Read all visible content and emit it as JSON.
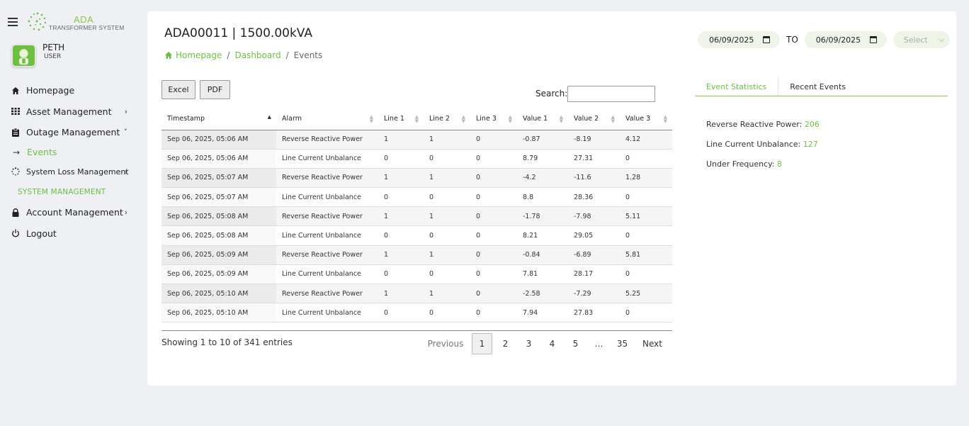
{
  "app": {
    "logo_title": "ADA",
    "logo_subtitle": "TRANSFORMER SYSTEM"
  },
  "user": {
    "name": "PETH",
    "role": "USER"
  },
  "sidebar": {
    "items": [
      {
        "label": "Homepage",
        "icon": "home-icon"
      },
      {
        "label": "Asset Management",
        "icon": "grid-icon",
        "chevron": "›"
      },
      {
        "label": "Outage Management",
        "icon": "clipboard-icon",
        "chevron": "˅"
      },
      {
        "label": "Events",
        "icon": "arrow-right-icon"
      },
      {
        "label": "System Loss Management",
        "icon": "spinner-icon",
        "chevron": "›"
      },
      {
        "label": "SYSTEM MANAGEMENT"
      },
      {
        "label": "Account Management",
        "icon": "lock-icon",
        "chevron": "›"
      },
      {
        "label": "Logout",
        "icon": "power-icon"
      }
    ]
  },
  "header": {
    "title": "ADA00011 | 1500.00kVA",
    "breadcrumb": [
      "Homepage",
      "Dashboard",
      "Events"
    ]
  },
  "filter": {
    "date_from": "06/09/2025",
    "to_label": "TO",
    "date_to": "06/09/2025",
    "select_placeholder": "Select"
  },
  "toolbar": {
    "excel_label": "Excel",
    "pdf_label": "PDF",
    "search_label": "Search:"
  },
  "table": {
    "columns": [
      "Timestamp",
      "Alarm",
      "Line 1",
      "Line 2",
      "Line 3",
      "Value 1",
      "Value 2",
      "Value 3"
    ],
    "rows": [
      [
        "Sep 06, 2025, 05:06 AM",
        "Reverse Reactive Power",
        "1",
        "1",
        "0",
        "-0.87",
        "-8.19",
        "4.12"
      ],
      [
        "Sep 06, 2025, 05:06 AM",
        "Line Current Unbalance",
        "0",
        "0",
        "0",
        "8.79",
        "27.31",
        "0"
      ],
      [
        "Sep 06, 2025, 05:07 AM",
        "Reverse Reactive Power",
        "1",
        "1",
        "0",
        "-4.2",
        "-11.6",
        "1.28"
      ],
      [
        "Sep 06, 2025, 05:07 AM",
        "Line Current Unbalance",
        "0",
        "0",
        "0",
        "8.8",
        "28.36",
        "0"
      ],
      [
        "Sep 06, 2025, 05:08 AM",
        "Reverse Reactive Power",
        "1",
        "1",
        "0",
        "-1.78",
        "-7.98",
        "5.11"
      ],
      [
        "Sep 06, 2025, 05:08 AM",
        "Line Current Unbalance",
        "0",
        "0",
        "0",
        "8.21",
        "29.05",
        "0"
      ],
      [
        "Sep 06, 2025, 05:09 AM",
        "Reverse Reactive Power",
        "1",
        "1",
        "0",
        "-0.84",
        "-6.89",
        "5.81"
      ],
      [
        "Sep 06, 2025, 05:09 AM",
        "Line Current Unbalance",
        "0",
        "0",
        "0",
        "7.81",
        "28.17",
        "0"
      ],
      [
        "Sep 06, 2025, 05:10 AM",
        "Reverse Reactive Power",
        "1",
        "1",
        "0",
        "-2.58",
        "-7.29",
        "5.25"
      ],
      [
        "Sep 06, 2025, 05:10 AM",
        "Line Current Unbalance",
        "0",
        "0",
        "0",
        "7.94",
        "27.83",
        "0"
      ]
    ],
    "info": "Showing 1 to 10 of 341 entries"
  },
  "pagination": {
    "previous": "Previous",
    "pages": [
      "1",
      "2",
      "3",
      "4",
      "5"
    ],
    "ellipsis": "…",
    "last": "35",
    "next": "Next"
  },
  "tabs": [
    "Event Statistics",
    "Recent Events"
  ],
  "stats": [
    {
      "label": "Reverse Reactive Power:",
      "value": "206"
    },
    {
      "label": "Line Current Unbalance:",
      "value": "127"
    },
    {
      "label": "Under Frequency:",
      "value": "8"
    }
  ],
  "colors": {
    "accent": "#6cbf3f",
    "background": "#eef0f4",
    "pill": "#eef5e8"
  }
}
